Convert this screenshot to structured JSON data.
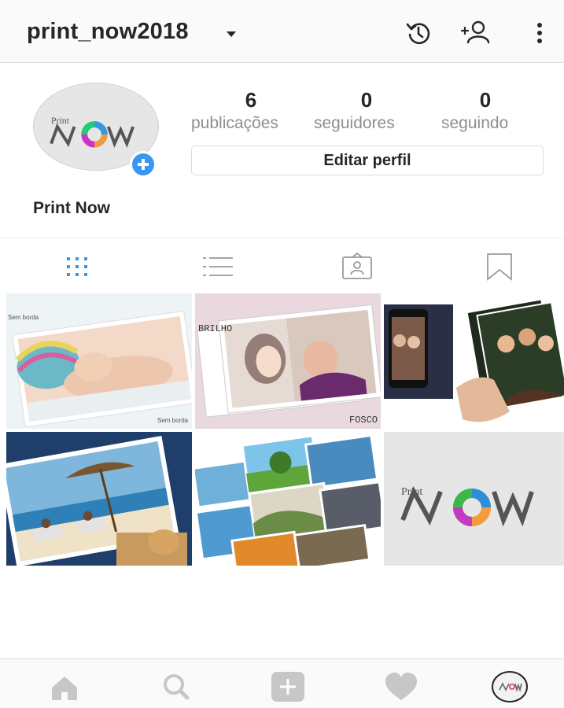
{
  "header": {
    "username": "print_now2018",
    "icons": [
      "caret-down-icon",
      "history-icon",
      "add-user-icon",
      "more-vertical-icon"
    ]
  },
  "profile": {
    "avatar_text": "Print NOW",
    "display_name": "Print Now",
    "stats": [
      {
        "value": "6",
        "label": "publicações"
      },
      {
        "value": "0",
        "label": "seguidores"
      },
      {
        "value": "0",
        "label": "seguindo"
      }
    ],
    "edit_button": "Editar perfil"
  },
  "tabs": [
    {
      "name": "grid-icon",
      "active": true
    },
    {
      "name": "list-icon",
      "active": false
    },
    {
      "name": "tagged-icon",
      "active": false
    },
    {
      "name": "saved-icon",
      "active": false
    }
  ],
  "posts": [
    {
      "caption_top": "Sem borda",
      "caption_bottom": "Sem borda",
      "subject": "baby photo prints"
    },
    {
      "caption_top": "BRILHO",
      "caption_bottom": "FOSCO",
      "subject": "couple photo prints"
    },
    {
      "subject": "phone and group photo prints"
    },
    {
      "subject": "beach photo prints"
    },
    {
      "subject": "landscape photo prints"
    },
    {
      "logo_small": "Print",
      "logo_big": "NOW"
    }
  ],
  "bottom_nav": [
    "home-icon",
    "search-icon",
    "add-icon",
    "heart-icon",
    "profile-avatar-icon"
  ],
  "colors": {
    "accent": "#3897f0",
    "text": "#262626",
    "secondary": "#8e8e8e",
    "border": "#dbdbdb"
  }
}
